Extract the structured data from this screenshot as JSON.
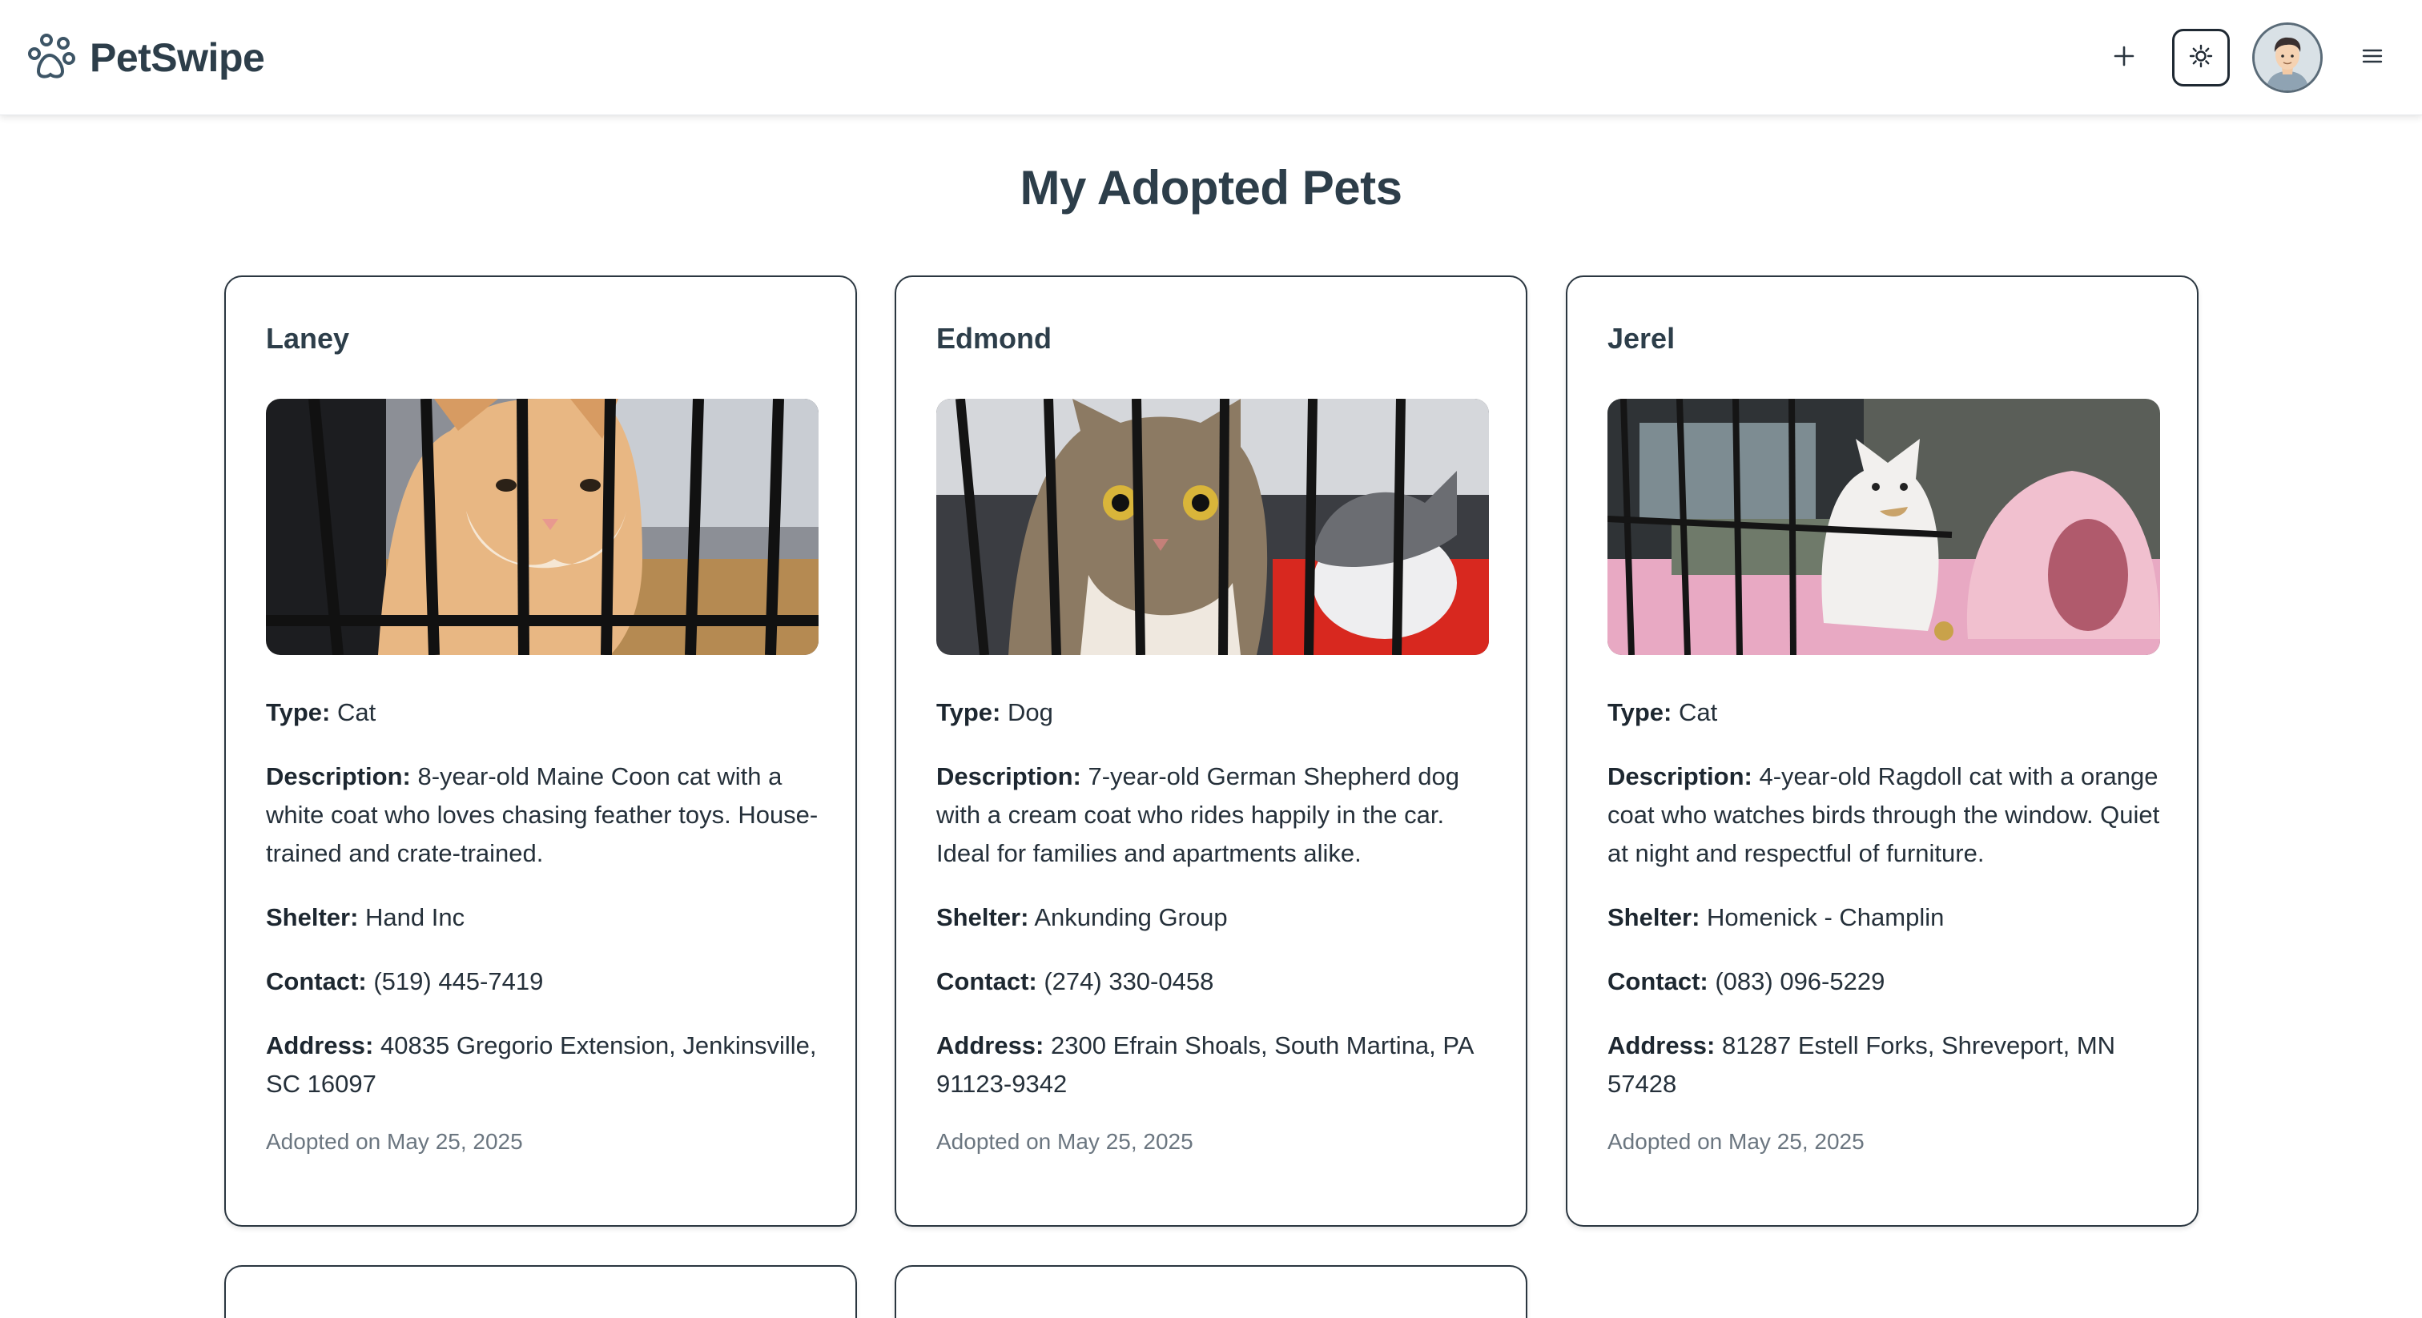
{
  "app": {
    "brand_name": "PetSwipe"
  },
  "header": {
    "icons": [
      "paw-icon",
      "plus-icon",
      "sun-icon",
      "avatar",
      "menu-icon"
    ]
  },
  "page_title": "My Adopted Pets",
  "labels": {
    "type": "Type:",
    "description": "Description:",
    "shelter": "Shelter:",
    "contact": "Contact:",
    "address": "Address:"
  },
  "pets": [
    {
      "name": "Laney",
      "type": "Cat",
      "description": "8-year-old Maine Coon cat with a white coat who loves chasing feather toys. House-trained and crate-trained.",
      "shelter": "Hand Inc",
      "contact": "(519) 445-7419",
      "address": "40835 Gregorio Extension, Jenkinsville, SC 16097",
      "adopted": "Adopted on May 25, 2025"
    },
    {
      "name": "Edmond",
      "type": "Dog",
      "description": "7-year-old German Shepherd dog with a cream coat who rides happily in the car. Ideal for families and apartments alike.",
      "shelter": "Ankunding Group",
      "contact": "(274) 330-0458",
      "address": "2300 Efrain Shoals, South Martina, PA 91123-9342",
      "adopted": "Adopted on May 25, 2025"
    },
    {
      "name": "Jerel",
      "type": "Cat",
      "description": "4-year-old Ragdoll cat with a orange coat who watches birds through the window. Quiet at night and respectful of furniture.",
      "shelter": "Homenick - Champlin",
      "contact": "(083) 096-5229",
      "address": "81287 Estell Forks, Shreveport, MN 57428",
      "adopted": "Adopted on May 25, 2025"
    }
  ],
  "colors": {
    "heading": "#2d3e4a",
    "card_border": "#2a3640",
    "muted_text": "#6b7680"
  }
}
